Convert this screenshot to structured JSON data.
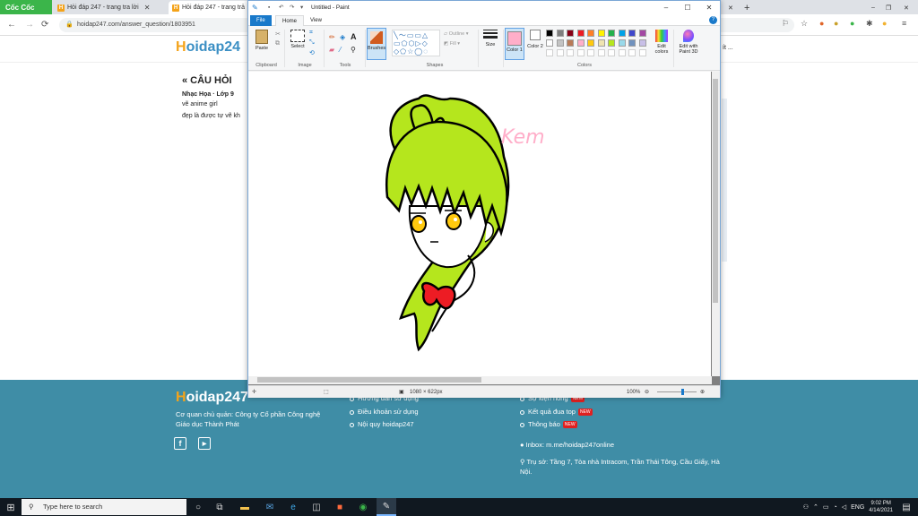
{
  "browser": {
    "name": "Cốc Cốc",
    "tabs": [
      {
        "title": "Hỏi đáp 247 - trang tra lời",
        "active": false
      },
      {
        "title": "Hỏi đáp 247 - trang trả",
        "active": true
      }
    ],
    "url": "hoidap247.com/answer_question/1803951"
  },
  "site": {
    "logo_h": "H",
    "logo_rest": "oidap24",
    "question_heading": "« CÂU HỎI",
    "meta": "Nhạc Họa · Lớp 9",
    "text1": "vẽ anime girl",
    "text2": "đẹp là được tự vẽ kh"
  },
  "paint": {
    "title": "Untitled - Paint",
    "tabs": {
      "file": "File",
      "home": "Home",
      "view": "View"
    },
    "ribbon": {
      "paste": "Paste",
      "select": "Select",
      "brushes": "Brushes",
      "outline": "Outline",
      "fill": "Fill",
      "size": "Size",
      "color1": "Color 1",
      "color2": "Color 2",
      "edit_colors": "Edit colors",
      "edit_3d": "Edit with Paint 3D"
    },
    "groups": {
      "clipboard": "Clipboard",
      "image": "Image",
      "tools": "Tools",
      "shapes": "Shapes",
      "colors": "Colors"
    },
    "palette_row1": [
      "#000000",
      "#7f7f7f",
      "#880015",
      "#ed1c24",
      "#ff7f27",
      "#fff200",
      "#22b14c",
      "#00a2e8",
      "#3f48cc",
      "#a349a4"
    ],
    "palette_row2": [
      "#ffffff",
      "#c3c3c3",
      "#b97a57",
      "#ffaec9",
      "#ffc90e",
      "#efe4b0",
      "#b5e61d",
      "#99d9ea",
      "#7092be",
      "#c8bfe7"
    ],
    "color1": "#ffaec9",
    "color2": "#ffffff",
    "canvas_text": "Kem",
    "status_size": "1080 × 622px",
    "zoom": "100%"
  },
  "footer": {
    "logo_h": "H",
    "logo_rest": "oidap247",
    "owner": "Cơ quan chủ quản: Công ty Cổ phần Công nghệ",
    "owner2": "Giáo dục Thành Phát",
    "links_col1": [
      "Hướng dẫn sử dụng",
      "Điều khoản sử dụng",
      "Nội quy hoidap247"
    ],
    "links_col2": [
      "Sự kiện hóng",
      "Kết quả đua top",
      "Thông báo"
    ],
    "new_badge": "NEW",
    "inbox": "Inbox: m.me/hoidap247online",
    "address1": "Trụ sở: Tầng 7, Tòa nhà Intracom, Trần Thái Tông, Cầu Giấy, Hà",
    "address2": "Nội."
  },
  "taskbar": {
    "search_placeholder": "Type here to search",
    "lang": "ENG",
    "time": "9:02 PM",
    "date": "4/14/2021"
  }
}
